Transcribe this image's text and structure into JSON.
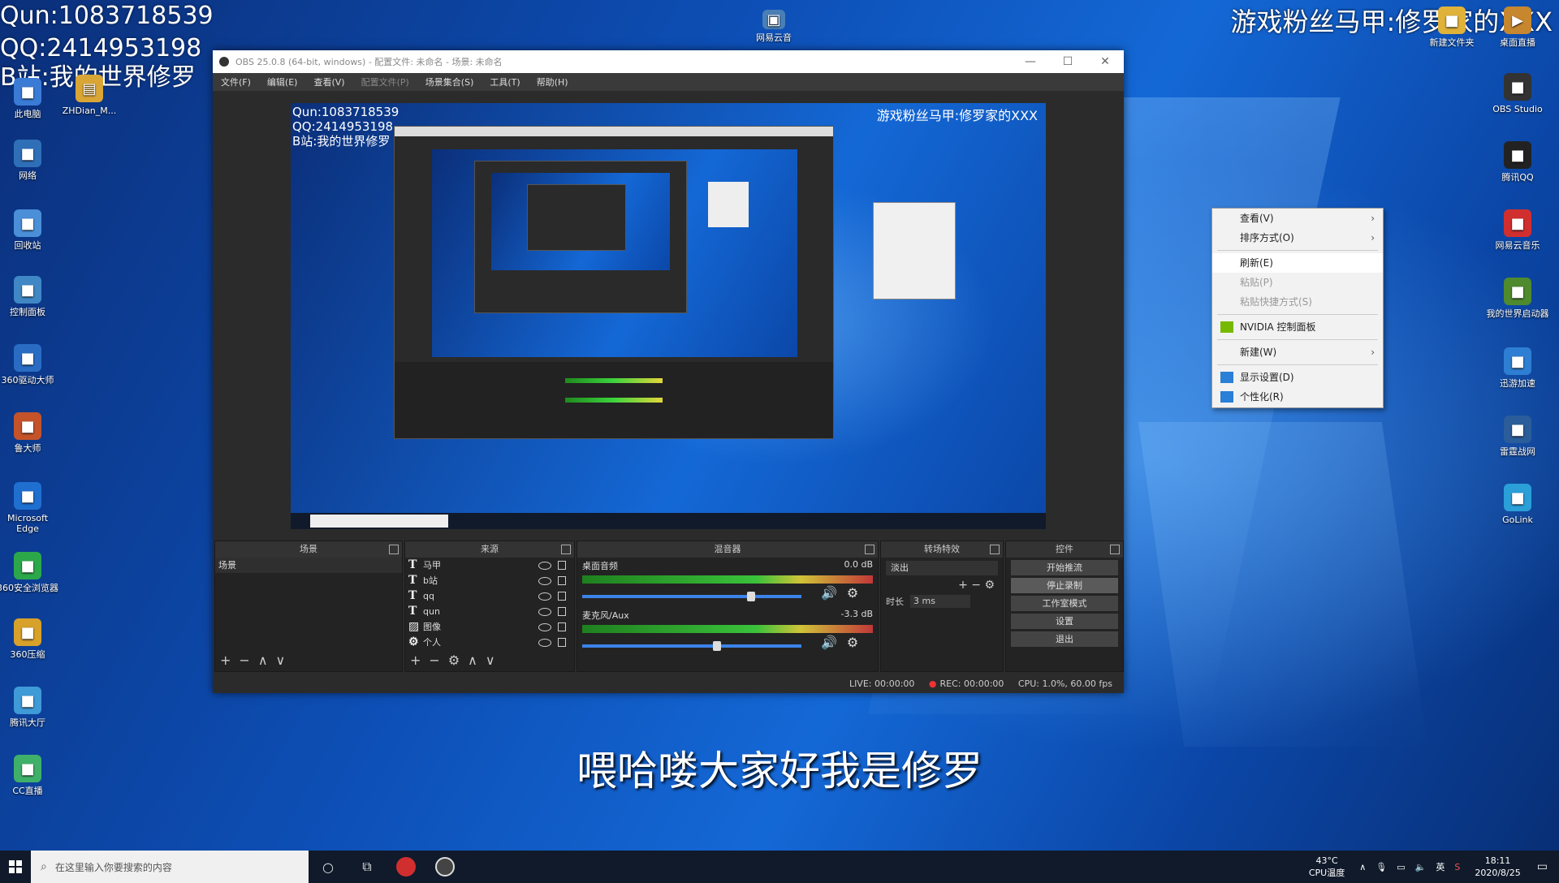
{
  "overlay": {
    "line1": "Qun:1083718539",
    "line2": "QQ:2414953198",
    "line3": "B站:我的世界修罗",
    "top_right": "游戏粉丝马甲:修罗家的XXX"
  },
  "desktop_icons_left": [
    {
      "label": "此电脑",
      "icon": "computer-icon",
      "color": "#3a7bd5"
    },
    {
      "label": "网络",
      "icon": "network-icon",
      "color": "#2f6fb8"
    },
    {
      "label": "回收站",
      "icon": "recycle-bin-icon",
      "color": "#4a8fd8"
    },
    {
      "label": "控制面板",
      "icon": "control-panel-icon",
      "color": "#3f88c5"
    },
    {
      "label": "360驱动大师",
      "icon": "driver-icon",
      "color": "#2a6cc4"
    },
    {
      "label": "鲁大师",
      "icon": "ludashi-icon",
      "color": "#c4532a"
    },
    {
      "label": "Microsoft Edge",
      "icon": "edge-icon",
      "color": "#1f6fd0"
    },
    {
      "label": "360安全浏览器",
      "icon": "browser-360-icon",
      "color": "#2ca84a"
    },
    {
      "label": "360压缩",
      "icon": "zip-icon",
      "color": "#d7a12a"
    },
    {
      "label": "腾讯大厅",
      "icon": "qq-game-icon",
      "color": "#3f9ad8"
    },
    {
      "label": "CC直播",
      "icon": "cc-live-icon",
      "color": "#3fb06a"
    }
  ],
  "desktop_icons_left_col2": [
    {
      "label": "ZHDian_M...",
      "icon": "folder-icon",
      "color": "#d9a636"
    }
  ],
  "desktop_icons_top": [
    {
      "label": "网易云音",
      "icon": "app-icon",
      "color": "#4a7fb5"
    }
  ],
  "desktop_icons_right": [
    {
      "label": "新建文件夹",
      "icon": "folder-icon",
      "color": "#e0b23a"
    },
    {
      "label": "网易云音乐",
      "icon": "netease-music-icon",
      "color": "#d12f2f"
    },
    {
      "label": "OBS Studio",
      "icon": "obs-icon",
      "color": "#333333"
    },
    {
      "label": "腾讯QQ",
      "icon": "qq-icon",
      "color": "#222222"
    },
    {
      "label": "网易云音乐",
      "icon": "netease-music-icon",
      "color": "#d12f2f"
    },
    {
      "label": "我的世界启动器",
      "icon": "minecraft-icon",
      "color": "#4f8a2f"
    },
    {
      "label": "迅游加速",
      "icon": "accelerator-icon",
      "color": "#2e7fd3"
    },
    {
      "label": "雷霆战网",
      "icon": "game-icon",
      "color": "#2a5d9a"
    },
    {
      "label": "GoLink",
      "icon": "golink-icon",
      "color": "#2a9fd8"
    }
  ],
  "desktop_icons_right_top2": [
    {
      "label": "桌面直播",
      "icon": "live-icon",
      "color": "#c7872f"
    }
  ],
  "obs": {
    "title": "OBS 25.0.8 (64-bit, windows) - 配置文件: 未命名 - 场景: 未命名",
    "menu": [
      "文件(F)",
      "编辑(E)",
      "查看(V)",
      "配置文件(P)",
      "场景集合(S)",
      "工具(T)",
      "帮助(H)"
    ],
    "preview_overlay_1": "Qun:1083718539",
    "preview_overlay_2": "QQ:2414953198",
    "preview_overlay_3": "B站:我的世界修罗",
    "preview_overlay_right": "游戏粉丝马甲:修罗家的XXX",
    "docks": {
      "scenes_title": "场景",
      "scene_items": [
        "场景"
      ],
      "sources_title": "来源",
      "sources": [
        {
          "name": "马甲",
          "type": "T"
        },
        {
          "name": "b站",
          "type": "T"
        },
        {
          "name": "qq",
          "type": "T"
        },
        {
          "name": "qun",
          "type": "T"
        },
        {
          "name": "图像",
          "type": "img"
        },
        {
          "name": "个人",
          "type": "gear"
        }
      ],
      "mixer_title": "混音器",
      "mixer": [
        {
          "name": "桌面音频",
          "db": "0.0 dB",
          "level": 0.78
        },
        {
          "name": "麦克风/Aux",
          "db": "-3.3 dB",
          "level": 0.62
        }
      ],
      "transitions_title": "转场特效",
      "transition": "淡出",
      "duration_label": "时长",
      "duration_value": "3 ms",
      "controls_title": "控件",
      "controls": [
        "开始推流",
        "停止录制",
        "工作室模式",
        "设置",
        "退出"
      ]
    },
    "status": {
      "live": "LIVE: 00:00:00",
      "rec": "REC: 00:00:00",
      "cpu": "CPU: 1.0%, 60.00 fps"
    }
  },
  "context_menu": {
    "items": [
      {
        "label": "查看(V)",
        "submenu": true,
        "state": "normal"
      },
      {
        "label": "排序方式(O)",
        "submenu": true,
        "state": "normal"
      },
      {
        "label": "刷新(E)",
        "submenu": false,
        "state": "highlight"
      },
      {
        "label": "粘贴(P)",
        "submenu": false,
        "state": "disabled"
      },
      {
        "label": "粘贴快捷方式(S)",
        "submenu": false,
        "state": "disabled"
      },
      {
        "label": "NVIDIA 控制面板",
        "submenu": false,
        "state": "normal",
        "icon": "nvidia-icon"
      },
      {
        "label": "新建(W)",
        "submenu": true,
        "state": "normal"
      },
      {
        "label": "显示设置(D)",
        "submenu": false,
        "state": "normal",
        "icon": "display-icon"
      },
      {
        "label": "个性化(R)",
        "submenu": false,
        "state": "normal",
        "icon": "personalize-icon"
      }
    ]
  },
  "subtitle": "喂哈喽大家好我是修罗",
  "taskbar": {
    "search_placeholder": "在这里输入你要搜索的内容",
    "cpu_temp": "43°C",
    "cpu_label": "CPU温度",
    "ime": "英",
    "time": "18:11",
    "date": "2020/8/25"
  }
}
